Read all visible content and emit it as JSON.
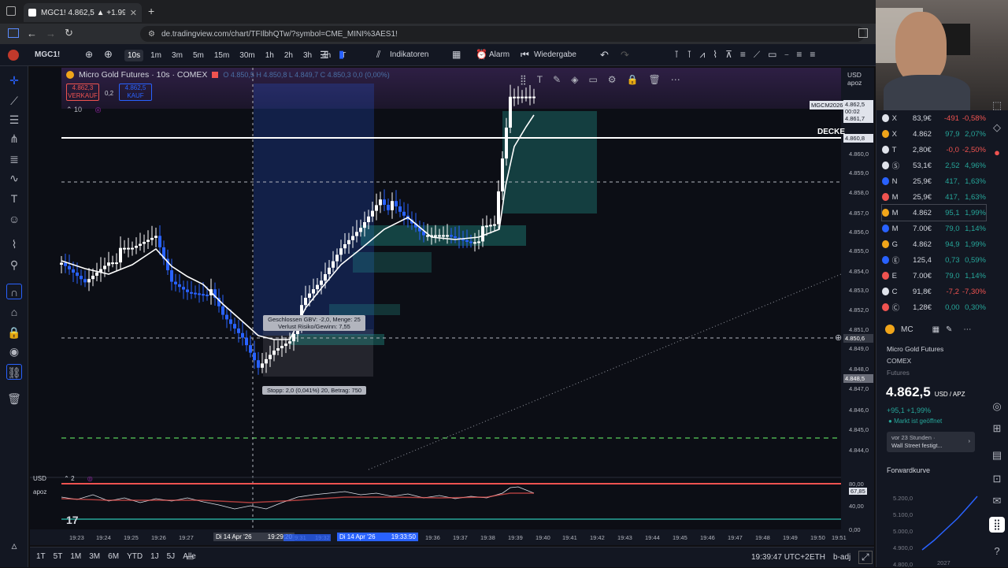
{
  "browser": {
    "tab_title": "MGC1! 4.862,5 ▲ +1.99% Nicht",
    "new_tab": "+",
    "url": "de.tradingview.com/chart/TFIlbhQTw/?symbol=CME_MINI%3AES1!"
  },
  "toolbar": {
    "symbol": "MGC1!",
    "intervals": [
      "10s",
      "1m",
      "3m",
      "5m",
      "15m",
      "30m",
      "1h",
      "2h",
      "3h",
      "4h",
      "T"
    ],
    "active_interval": "10s",
    "indicators_label": "Indikatoren",
    "alarm_label": "Alarm",
    "replay_label": "Wiedergabe"
  },
  "legend": {
    "title": "Micro Gold Futures · 10s · COMEX",
    "ohlc": "O 4.850,5  H 4.850,8  L 4.849,7  C 4.850,3  0,0 (0,00%)",
    "sell_price": "4.862,3",
    "sell_label": "VERKAUF",
    "spread": "0,2",
    "buy_price": "4.862,5",
    "buy_label": "KAUF",
    "sub_value": "10"
  },
  "price_axis": {
    "currency": "USD",
    "sub": "apoz",
    "labels": [
      "4.860,0",
      "4.859,0",
      "4.858,0",
      "4.857,0",
      "4.856,0",
      "4.855,0",
      "4.854,0",
      "4.853,0",
      "4.852,0",
      "4.851,0",
      "4.849,0",
      "4.848,0",
      "4.847,0",
      "4.846,0",
      "4.845,0",
      "4.844,0"
    ],
    "current": "4.862,5",
    "countdown": "00:02",
    "current_low": "4.861,7",
    "decke_price": "4.860,8",
    "crosshair": "4.850,6",
    "stop_price": "4.848,5",
    "symbol_tag": "MGCM2026"
  },
  "drawings": {
    "decke_label": "DECKE",
    "position_label_1": "Geschlossen GBV: -2,0, Menge: 25",
    "position_label_2": "Verlust  Risiko/Gewinn: 7,55",
    "stop_label": "Stopp: 2,0 (0,041%) 20, Betrag: 750"
  },
  "indicator_pane": {
    "currency": "USD",
    "sub": "apoz",
    "number": "2",
    "axis": [
      "80,00",
      "67,85",
      "40,00",
      "0,00"
    ]
  },
  "time_axis": {
    "labels": [
      "19:23",
      "19:24",
      "19:25",
      "19:26",
      "19:27",
      "19:28",
      "19:30",
      "19:31",
      "19:32",
      "19:33",
      "19:34",
      "19:35",
      "19:36",
      "19:37",
      "19:38",
      "19:39",
      "19:40",
      "19:41",
      "19:42",
      "19:43",
      "19:44",
      "19:45",
      "19:46",
      "19:47",
      "19:48",
      "19:49",
      "19:50",
      "19:51"
    ],
    "highlight_1": "Di 14 Apr '26",
    "highlight_1_time": "19:29:20",
    "highlight_2": "Di 14 Apr '26",
    "highlight_2_time": "19:33:50"
  },
  "bottom_bar": {
    "ranges": [
      "1T",
      "5T",
      "1M",
      "3M",
      "6M",
      "YTD",
      "1J",
      "5J",
      "Alle"
    ],
    "clock": "19:39:47 UTC+2",
    "session": "ETH",
    "adj": "b-adj"
  },
  "watchlist": [
    {
      "sym": "X",
      "price": "83,9€",
      "chg": "-491",
      "pct": "-0,58%",
      "dir": "neg",
      "color": "#e0e3eb"
    },
    {
      "sym": "X",
      "price": "4.862",
      "chg": "97,9",
      "pct": "2,07%",
      "dir": "pos",
      "color": "#f0a51a"
    },
    {
      "sym": "T",
      "price": "2,80€",
      "chg": "-0,0",
      "pct": "-2,50%",
      "dir": "neg",
      "color": "#e0e3eb"
    },
    {
      "sym": "Ⓢ",
      "price": "53,1€",
      "chg": "2,52",
      "pct": "4,96%",
      "dir": "pos",
      "color": "#e0e3eb"
    },
    {
      "sym": "N",
      "price": "25,9€",
      "chg": "417,",
      "pct": "1,63%",
      "dir": "pos",
      "color": "#2962ff"
    },
    {
      "sym": "M",
      "price": "25,9€",
      "chg": "417,",
      "pct": "1,63%",
      "dir": "pos",
      "color": "#ef5350"
    },
    {
      "sym": "M",
      "price": "4.862",
      "chg": "95,1",
      "pct": "1,99%",
      "dir": "pos",
      "color": "#f0a51a"
    },
    {
      "sym": "M",
      "price": "7.00€",
      "chg": "79,0",
      "pct": "1,14%",
      "dir": "pos",
      "color": "#2962ff"
    },
    {
      "sym": "G",
      "price": "4.862",
      "chg": "94,9",
      "pct": "1,99%",
      "dir": "pos",
      "color": "#f0a51a"
    },
    {
      "sym": "Ⓔ",
      "price": "125,4",
      "chg": "0,73",
      "pct": "0,59%",
      "dir": "pos",
      "color": "#2962ff"
    },
    {
      "sym": "E",
      "price": "7.00€",
      "chg": "79,0",
      "pct": "1,14%",
      "dir": "pos",
      "color": "#ef5350"
    },
    {
      "sym": "C",
      "price": "91,8€",
      "chg": "-7,2",
      "pct": "-7,30%",
      "dir": "neg",
      "color": "#e0e3eb"
    },
    {
      "sym": "Ⓒ",
      "price": "1,28€",
      "chg": "0,00",
      "pct": "0,30%",
      "dir": "pos",
      "color": "#ef5350"
    }
  ],
  "details": {
    "header_sym": "MC",
    "name": "Micro Gold Futures",
    "exchange": "COMEX",
    "type": "Futures",
    "price_main": "4.862,",
    "price_dec": "5",
    "unit": "USD / APZ",
    "change": "+95,1 +1,99%",
    "market_status": "Markt ist geöffnet",
    "news_time": "vor 23 Stunden ·",
    "news_title": "Wall Street festigt...",
    "forward_title": "Forwardkurve",
    "forward_axis": [
      "5.200,0",
      "5.100,0",
      "5.000,0",
      "4.900,0",
      "4.800,0"
    ],
    "forward_year": "2027"
  },
  "colors": {
    "up": "#ffffff",
    "down": "#2962ff",
    "green": "#26a69a",
    "red": "#ef5350"
  }
}
